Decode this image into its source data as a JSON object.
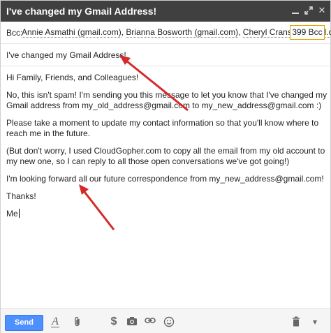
{
  "window": {
    "title": "I've changed my Gmail Address!",
    "controls": {
      "minimize_icon": "minimize-icon",
      "maximize_icon": "maximize-icon",
      "close_icon": "close-icon"
    }
  },
  "bcc": {
    "label": "Bcc:",
    "recipients": [
      "Annie Asmathi (gmail.com)",
      "Brianna Bosworth (gmail.com)",
      "Cheryl Cranson (gmail.com)"
    ],
    "count_badge": "399 Bcc"
  },
  "subject": "I've changed my Gmail Address!",
  "body": {
    "greeting": "Hi Family, Friends, and Colleagues!",
    "p1": "No, this isn't spam!  I'm sending you this message to let you know that I've changed my Gmail address from my_old_address@gmail.com to my_new_address@gmail.com  :)",
    "p2": "Please take a moment to update my contact information so that you'll know where to reach me in the future.",
    "p3": "(But don't worry, I used CloudGopher.com to copy all the email from my old account to my new one, so I can reply to all those open conversations we've got going!)",
    "p4": "I'm looking forward all our future correspondence from my_new_address@gmail.com!",
    "thanks": "Thanks!",
    "signature": "Me"
  },
  "toolbar": {
    "send_label": "Send",
    "icons": [
      "formatting-icon",
      "attach-icon",
      "money-icon",
      "photo-icon",
      "link-icon",
      "emoji-icon",
      "trash-icon",
      "more-options-icon"
    ]
  },
  "colors": {
    "titlebar_bg": "#404040",
    "send_button": "#4d90fe",
    "count_border": "#e0a800",
    "arrow": "#d42a2a"
  }
}
